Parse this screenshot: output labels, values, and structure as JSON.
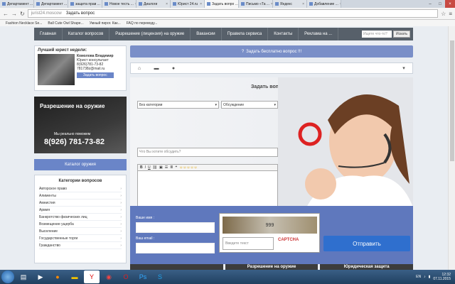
{
  "browser": {
    "tabs": [
      "Департамент ...",
      "Департамент ...",
      "защита прав ...",
      "Новое тесть ...",
      "Диалоги",
      "Юрист 24.ru",
      "Задать вопро ...",
      "Письмо «Та ...",
      "Яндекс",
      "Добавление ..."
    ],
    "active_tab": 6,
    "url": "jurist24.moscow",
    "page_title": "Задать вопрос",
    "bookmarks": [
      "Fashion Necklace Se...",
      "Ball Cute Owl Shape...",
      "Умный пирог. Как...",
      "FAQ по переводу..."
    ]
  },
  "nav": {
    "items": [
      "Главная",
      "Каталог вопросов",
      "Разрешение (лицензия) на оружие",
      "Вакансии",
      "Правила сервиса",
      "Контакты",
      "Реклама на ..."
    ],
    "search_placeholder": "Ищете что-то?",
    "search_button": "Искать"
  },
  "lawyer": {
    "heading": "Лучший юрист недели:",
    "name": "Комолова Владимир",
    "role": "Юрист консультант",
    "phone": "8(926)781-73-82",
    "email": "781738z@mail.ru",
    "button": "Задать вопрос"
  },
  "weapon_banner": {
    "title": "Разрешение на оружие",
    "subtitle": "Мы реально поможем",
    "phone": "8(926) 781-73-82"
  },
  "weapon_catalog": "Каталог оружия",
  "categories": {
    "title": "Категории вопросов",
    "items": [
      "Авторское право",
      "Алименты",
      "Амнистия",
      "Армия",
      "Банкротство физических лиц",
      "Возмещение ущерба",
      "Выселение",
      "Государственные торги",
      "Гражданство"
    ]
  },
  "free_question": "Задать бесплатно вопрос !!!",
  "form": {
    "title": "Задать вопрос",
    "category_select": "Без категории",
    "type_select": "Обсуждение",
    "topic_placeholder": "Что Вы хотите обсудить?",
    "name_label": "Ваше имя :",
    "email_label": "Ваш email :",
    "captcha_placeholder": "Введите текст",
    "captcha_text": "999",
    "captcha_logo": "CAPTCHA",
    "submit": "Отправить"
  },
  "bottom_banners": [
    "",
    "Разрешение на оружие",
    "Юридическая защита"
  ],
  "taskbar": {
    "lang": "EN",
    "time": "12:32",
    "date": "07.11.2015"
  },
  "colors": {
    "nav": "#57606a",
    "accent": "#6a85c8",
    "submit": "#2f6fce"
  }
}
